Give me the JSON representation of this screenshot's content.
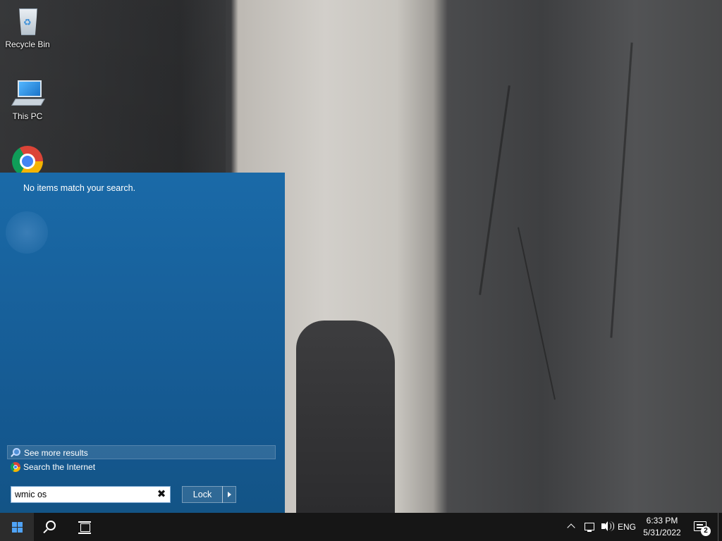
{
  "desktop": {
    "icons": [
      {
        "label": "Recycle Bin",
        "icon": "recycle-bin-icon"
      },
      {
        "label": "This PC",
        "icon": "computer-icon"
      },
      {
        "label": "",
        "icon": "chrome-icon"
      }
    ]
  },
  "start_panel": {
    "message": "No items match your search.",
    "results": [
      {
        "label": "See more results",
        "icon": "search-icon"
      },
      {
        "label": "Search the Internet",
        "icon": "chrome-icon"
      }
    ],
    "search": {
      "value": "wmic os",
      "clear_label": "✖"
    },
    "lock_label": "Lock"
  },
  "taskbar": {
    "language": "ENG",
    "time": "6:33 PM",
    "date": "5/31/2022",
    "notification_count": "2"
  }
}
